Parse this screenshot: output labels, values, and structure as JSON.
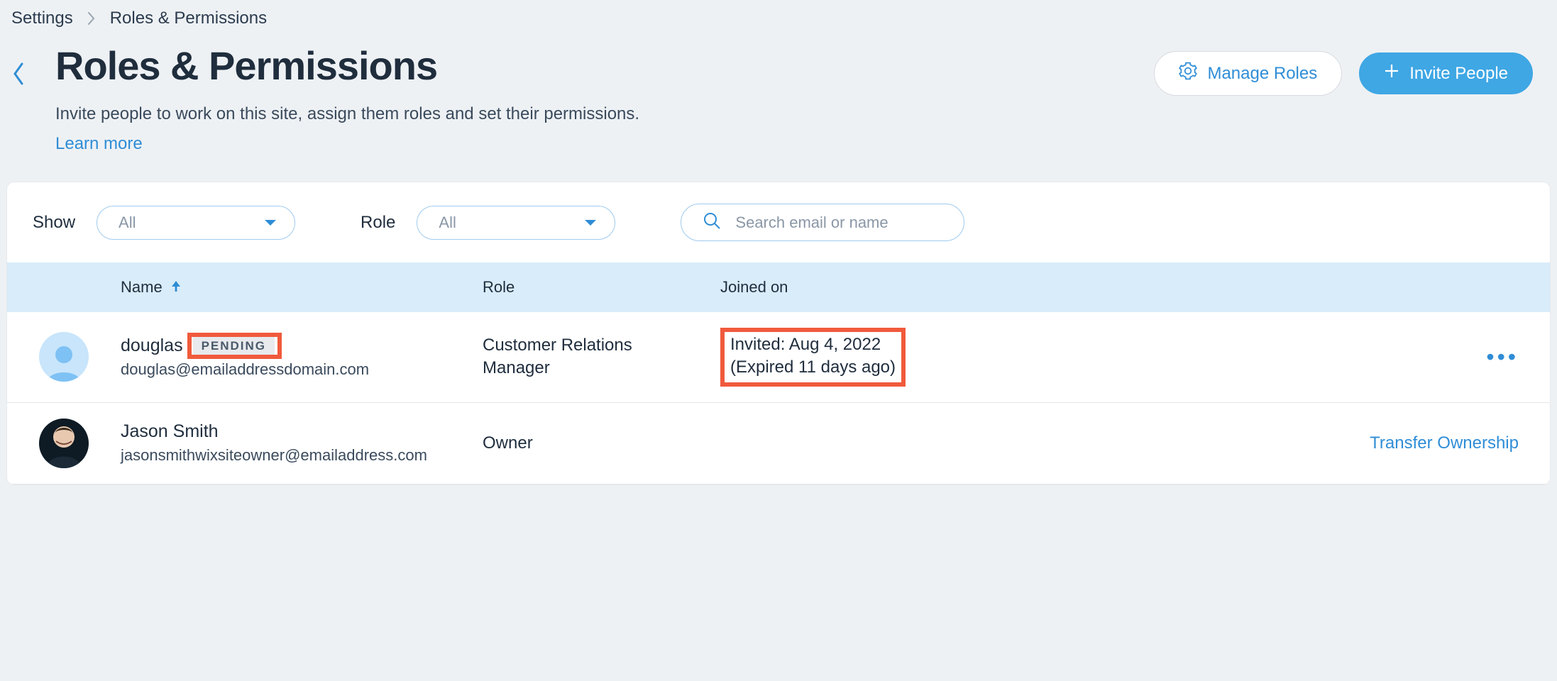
{
  "breadcrumb": {
    "parent": "Settings",
    "current": "Roles & Permissions"
  },
  "header": {
    "title": "Roles & Permissions",
    "subtitle": "Invite people to work on this site, assign them roles and set their permissions.",
    "learn_more": "Learn more",
    "manage_roles": "Manage Roles",
    "invite_people": "Invite People"
  },
  "filters": {
    "show_label": "Show",
    "show_value": "All",
    "role_label": "Role",
    "role_value": "All",
    "search_placeholder": "Search email or name"
  },
  "table": {
    "columns": {
      "name": "Name",
      "role": "Role",
      "joined": "Joined on"
    }
  },
  "rows": [
    {
      "name": "douglas",
      "badge": "PENDING",
      "email": "douglas@emailaddressdomain.com",
      "role": "Customer Relations Manager",
      "joined_line1": "Invited: Aug 4, 2022",
      "joined_line2": "(Expired 11 days ago)",
      "action": "more"
    },
    {
      "name": "Jason Smith",
      "email": "jasonsmithwixsiteowner@emailaddress.com",
      "role": "Owner",
      "action_label": "Transfer Ownership"
    }
  ]
}
